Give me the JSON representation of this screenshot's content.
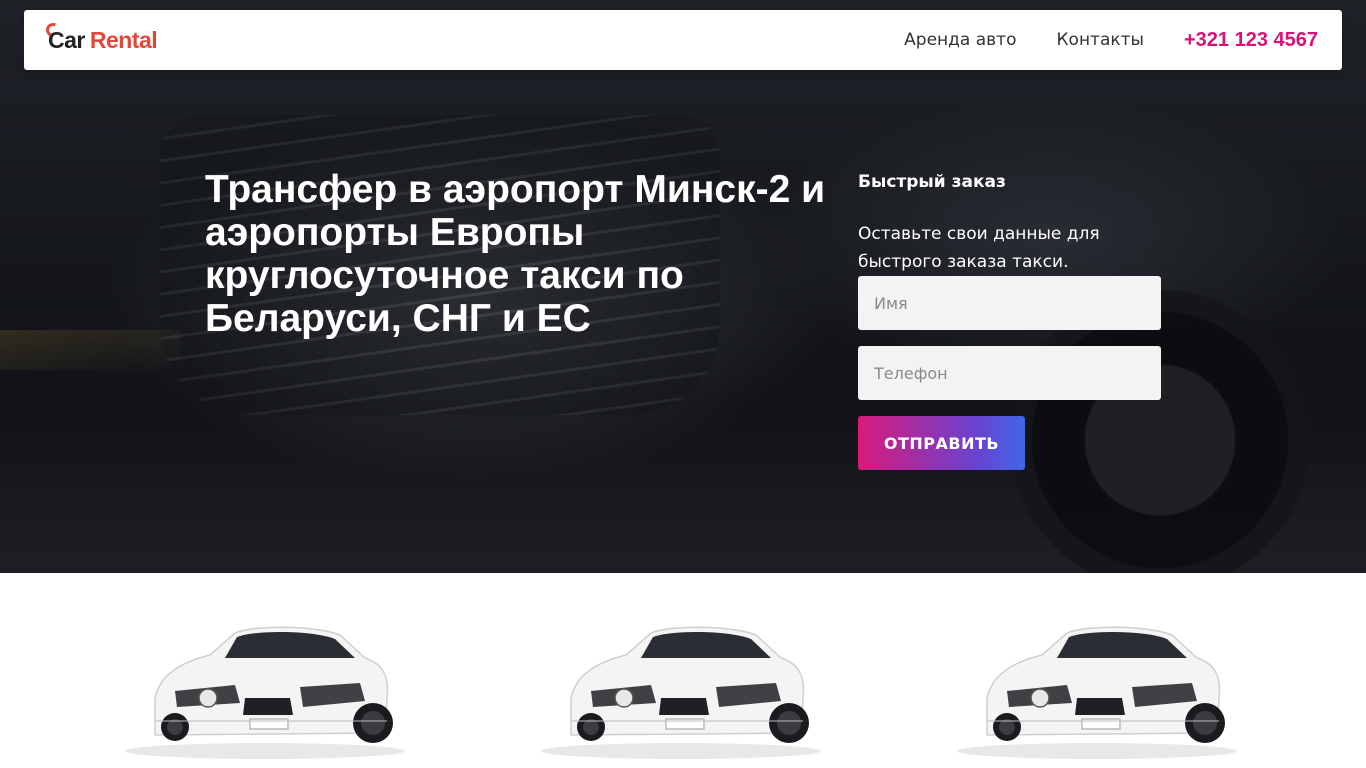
{
  "header": {
    "logo": {
      "part1": "Car",
      "part2": "Rental"
    },
    "nav": [
      {
        "label": "Аренда авто"
      },
      {
        "label": "Контакты"
      }
    ],
    "phone": "+321 123 4567"
  },
  "hero": {
    "title": "Трансфер в аэропорт Минск-2 и аэропорты Европы круглосуточное такси по Беларуси, СНГ и ЕС"
  },
  "quick_order": {
    "title": "Быстрый заказ",
    "description": "Оставьте свои данные для быстрого заказа такси.",
    "name_placeholder": "Имя",
    "phone_placeholder": "Телефон",
    "submit_label": "ОТПРАВИТЬ"
  },
  "cars": [
    {
      "image": "white-mercedes-coupe"
    },
    {
      "image": "white-mercedes-coupe"
    },
    {
      "image": "white-mercedes-coupe"
    }
  ],
  "colors": {
    "accent": "#d6127a",
    "logo_red": "#e0493a",
    "button_gradient_start": "#d91a7a",
    "button_gradient_end": "#3f68e6"
  }
}
